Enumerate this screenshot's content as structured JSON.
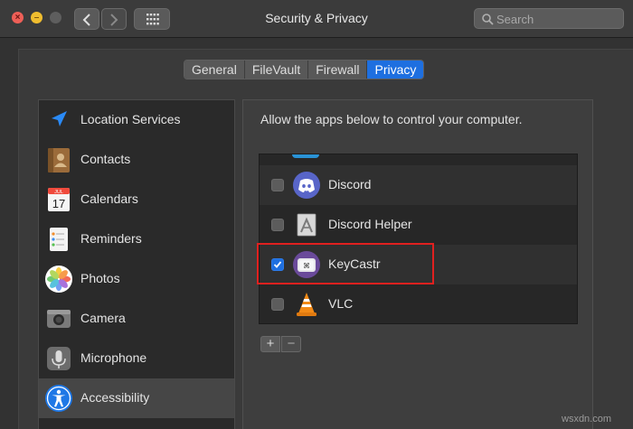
{
  "window": {
    "title": "Security & Privacy"
  },
  "search": {
    "placeholder": "Search",
    "value": ""
  },
  "tabs": [
    {
      "label": "General",
      "active": false
    },
    {
      "label": "FileVault",
      "active": false
    },
    {
      "label": "Firewall",
      "active": false
    },
    {
      "label": "Privacy",
      "active": true
    }
  ],
  "sidebar": {
    "items": [
      {
        "label": "Location Services",
        "icon": "location-arrow-icon",
        "selected": false
      },
      {
        "label": "Contacts",
        "icon": "contacts-book-icon",
        "selected": false
      },
      {
        "label": "Calendars",
        "icon": "calendar-icon",
        "selected": false
      },
      {
        "label": "Reminders",
        "icon": "reminders-list-icon",
        "selected": false
      },
      {
        "label": "Photos",
        "icon": "photos-flower-icon",
        "selected": false
      },
      {
        "label": "Camera",
        "icon": "camera-icon",
        "selected": false
      },
      {
        "label": "Microphone",
        "icon": "microphone-icon",
        "selected": false
      },
      {
        "label": "Accessibility",
        "icon": "accessibility-person-icon",
        "selected": true
      }
    ],
    "calendar_icon": {
      "month": "JUL",
      "day": "17"
    }
  },
  "panel": {
    "title": "Allow the apps below to control your computer.",
    "apps": [
      {
        "label": "Discord",
        "checked": false,
        "icon": "discord-icon"
      },
      {
        "label": "Discord Helper",
        "checked": false,
        "icon": "discord-helper-app-icon"
      },
      {
        "label": "KeyCastr",
        "checked": true,
        "icon": "keycastr-icon",
        "highlighted": true
      },
      {
        "label": "VLC",
        "checked": false,
        "icon": "vlc-cone-icon"
      }
    ],
    "add_label": "+",
    "remove_label": "−"
  },
  "watermark": "wsxdn.com",
  "colors": {
    "accent": "#1e6fe0",
    "highlight": "#e0201f"
  }
}
